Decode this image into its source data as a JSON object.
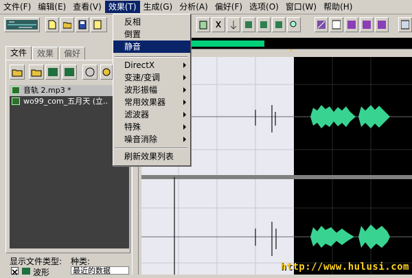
{
  "menubar": {
    "items": [
      {
        "label": "文件(F)"
      },
      {
        "label": "编辑(E)"
      },
      {
        "label": "查看(V)"
      },
      {
        "label": "效果(T)"
      },
      {
        "label": "生成(G)"
      },
      {
        "label": "分析(A)"
      },
      {
        "label": "偏好(F)"
      },
      {
        "label": "选项(O)"
      },
      {
        "label": "窗口(W)"
      },
      {
        "label": "帮助(H)"
      }
    ],
    "active_index": 3
  },
  "effects_menu": {
    "items": [
      {
        "label": "反相",
        "submenu": false
      },
      {
        "label": "倒置",
        "submenu": false
      },
      {
        "label": "静音",
        "submenu": false,
        "highlighted": true
      },
      {
        "label": "DirectX",
        "submenu": true
      },
      {
        "label": "变速/变调",
        "submenu": true
      },
      {
        "label": "波形振幅",
        "submenu": true
      },
      {
        "label": "常用效果器",
        "submenu": true
      },
      {
        "label": "滤波器",
        "submenu": true
      },
      {
        "label": "特殊",
        "submenu": true
      },
      {
        "label": "噪音消除",
        "submenu": true
      },
      {
        "label": "刷新效果列表",
        "submenu": false
      }
    ]
  },
  "tabs": [
    {
      "label": "文件",
      "active": true
    },
    {
      "label": "效果",
      "active": false
    },
    {
      "label": "偏好",
      "active": false
    }
  ],
  "files": [
    {
      "name": "音轨  2.mp3 *",
      "selected": true
    },
    {
      "name": "wo99_com_五月天 (立..",
      "selected": false
    }
  ],
  "bottom": {
    "show_type_label": "显示文件类型:",
    "kind_label": "种类:",
    "waveform_checkbox": "波形",
    "recent_select": "最近的数据"
  },
  "watermark": "http://www.hulusi.com",
  "colors": {
    "wave": "#39d391",
    "selection_bg": "#e9e9f1",
    "progress": "#00d07a",
    "menu_highlight": "#0a246a"
  }
}
